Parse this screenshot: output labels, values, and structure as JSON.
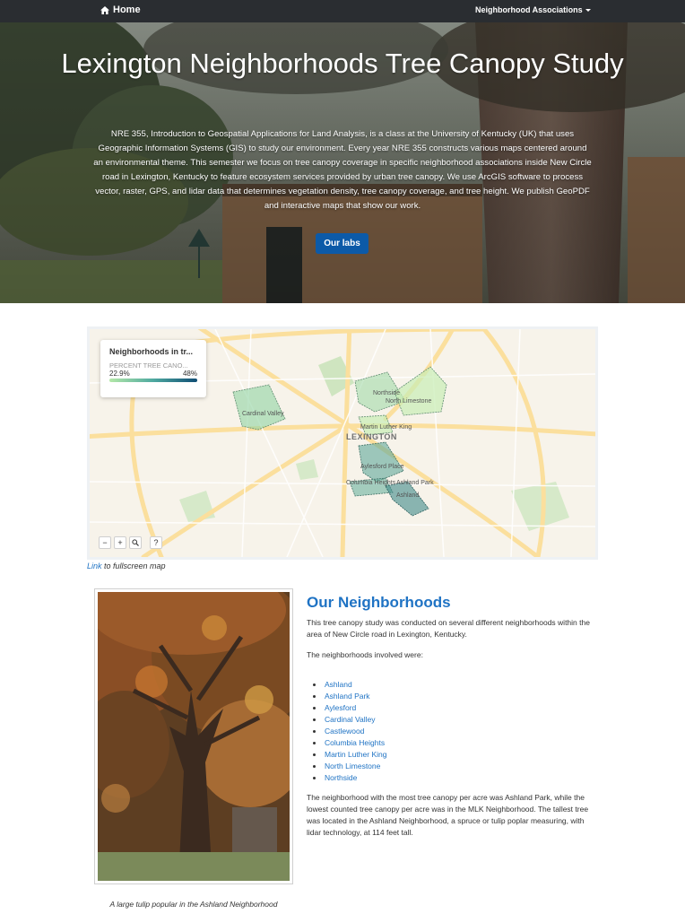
{
  "navbar": {
    "home_label": "Home",
    "dropdown_label": "Neighborhood Associations"
  },
  "hero": {
    "title": "Lexington Neighborhoods Tree Canopy Study",
    "description": "NRE 355, Introduction to Geospatial Applications for Land Analysis, is a class at the University of Kentucky (UK) that uses Geographic Information Systems (GIS) to study our environment. Every year NRE 355 constructs various maps centered around an environmental theme. This semester we focus on tree canopy coverage in specific neighborhood associations inside New Circle road in Lexington, Kentucky to feature ecosystem services provided by urban tree canopy. We use ArcGIS software to process vector, raster, GPS, and lidar data that determines vegetation density, tree canopy coverage, and tree height. We publish GeoPDF and interactive maps that show our work.",
    "button_label": "Our labs"
  },
  "map": {
    "legend_title": "Neighborhoods in tr...",
    "legend_subtitle": "PERCENT TREE CANO...",
    "legend_min": "22.9%",
    "legend_max": "48%",
    "city_label": "LEXINGTON",
    "neighborhood_labels": [
      "Cardinal Valley",
      "Northside",
      "North Limestone",
      "Martin Luther King",
      "Aylesford Place",
      "Columbia Heights",
      "Ashland Park",
      "Ashland"
    ],
    "zoom_out": "−",
    "zoom_in": "+",
    "search": "⌕",
    "help": "?",
    "caption_link": "Link",
    "caption_text": " to fullscreen map"
  },
  "photo": {
    "caption": "A large tulip popular in the Ashland Neighborhood"
  },
  "content": {
    "title": "Our Neighborhoods",
    "intro": "This tree canopy study was conducted on several different neighborhoods within the area of New Circle road in Lexington, Kentucky.",
    "list_intro": "The neighborhoods involved were:",
    "neighborhoods": [
      "Ashland",
      "Ashland Park",
      "Aylesford",
      "Cardinal Valley",
      "Castlewood",
      "Columbia Heights",
      "Martin Luther King",
      "North Limestone",
      "Northside"
    ],
    "summary": "The neighborhood with the most tree canopy per acre was Ashland Park, while the lowest counted tree canopy per acre was in the MLK Neighborhood. The tallest tree was located in the Ashland Neighborhood, a spruce or tulip poplar measuring, with lidar technology, at 114 feet tall."
  },
  "colors": {
    "navbar": "#2a2d31",
    "link": "#1f73c4",
    "button": "#0c5aa8"
  }
}
